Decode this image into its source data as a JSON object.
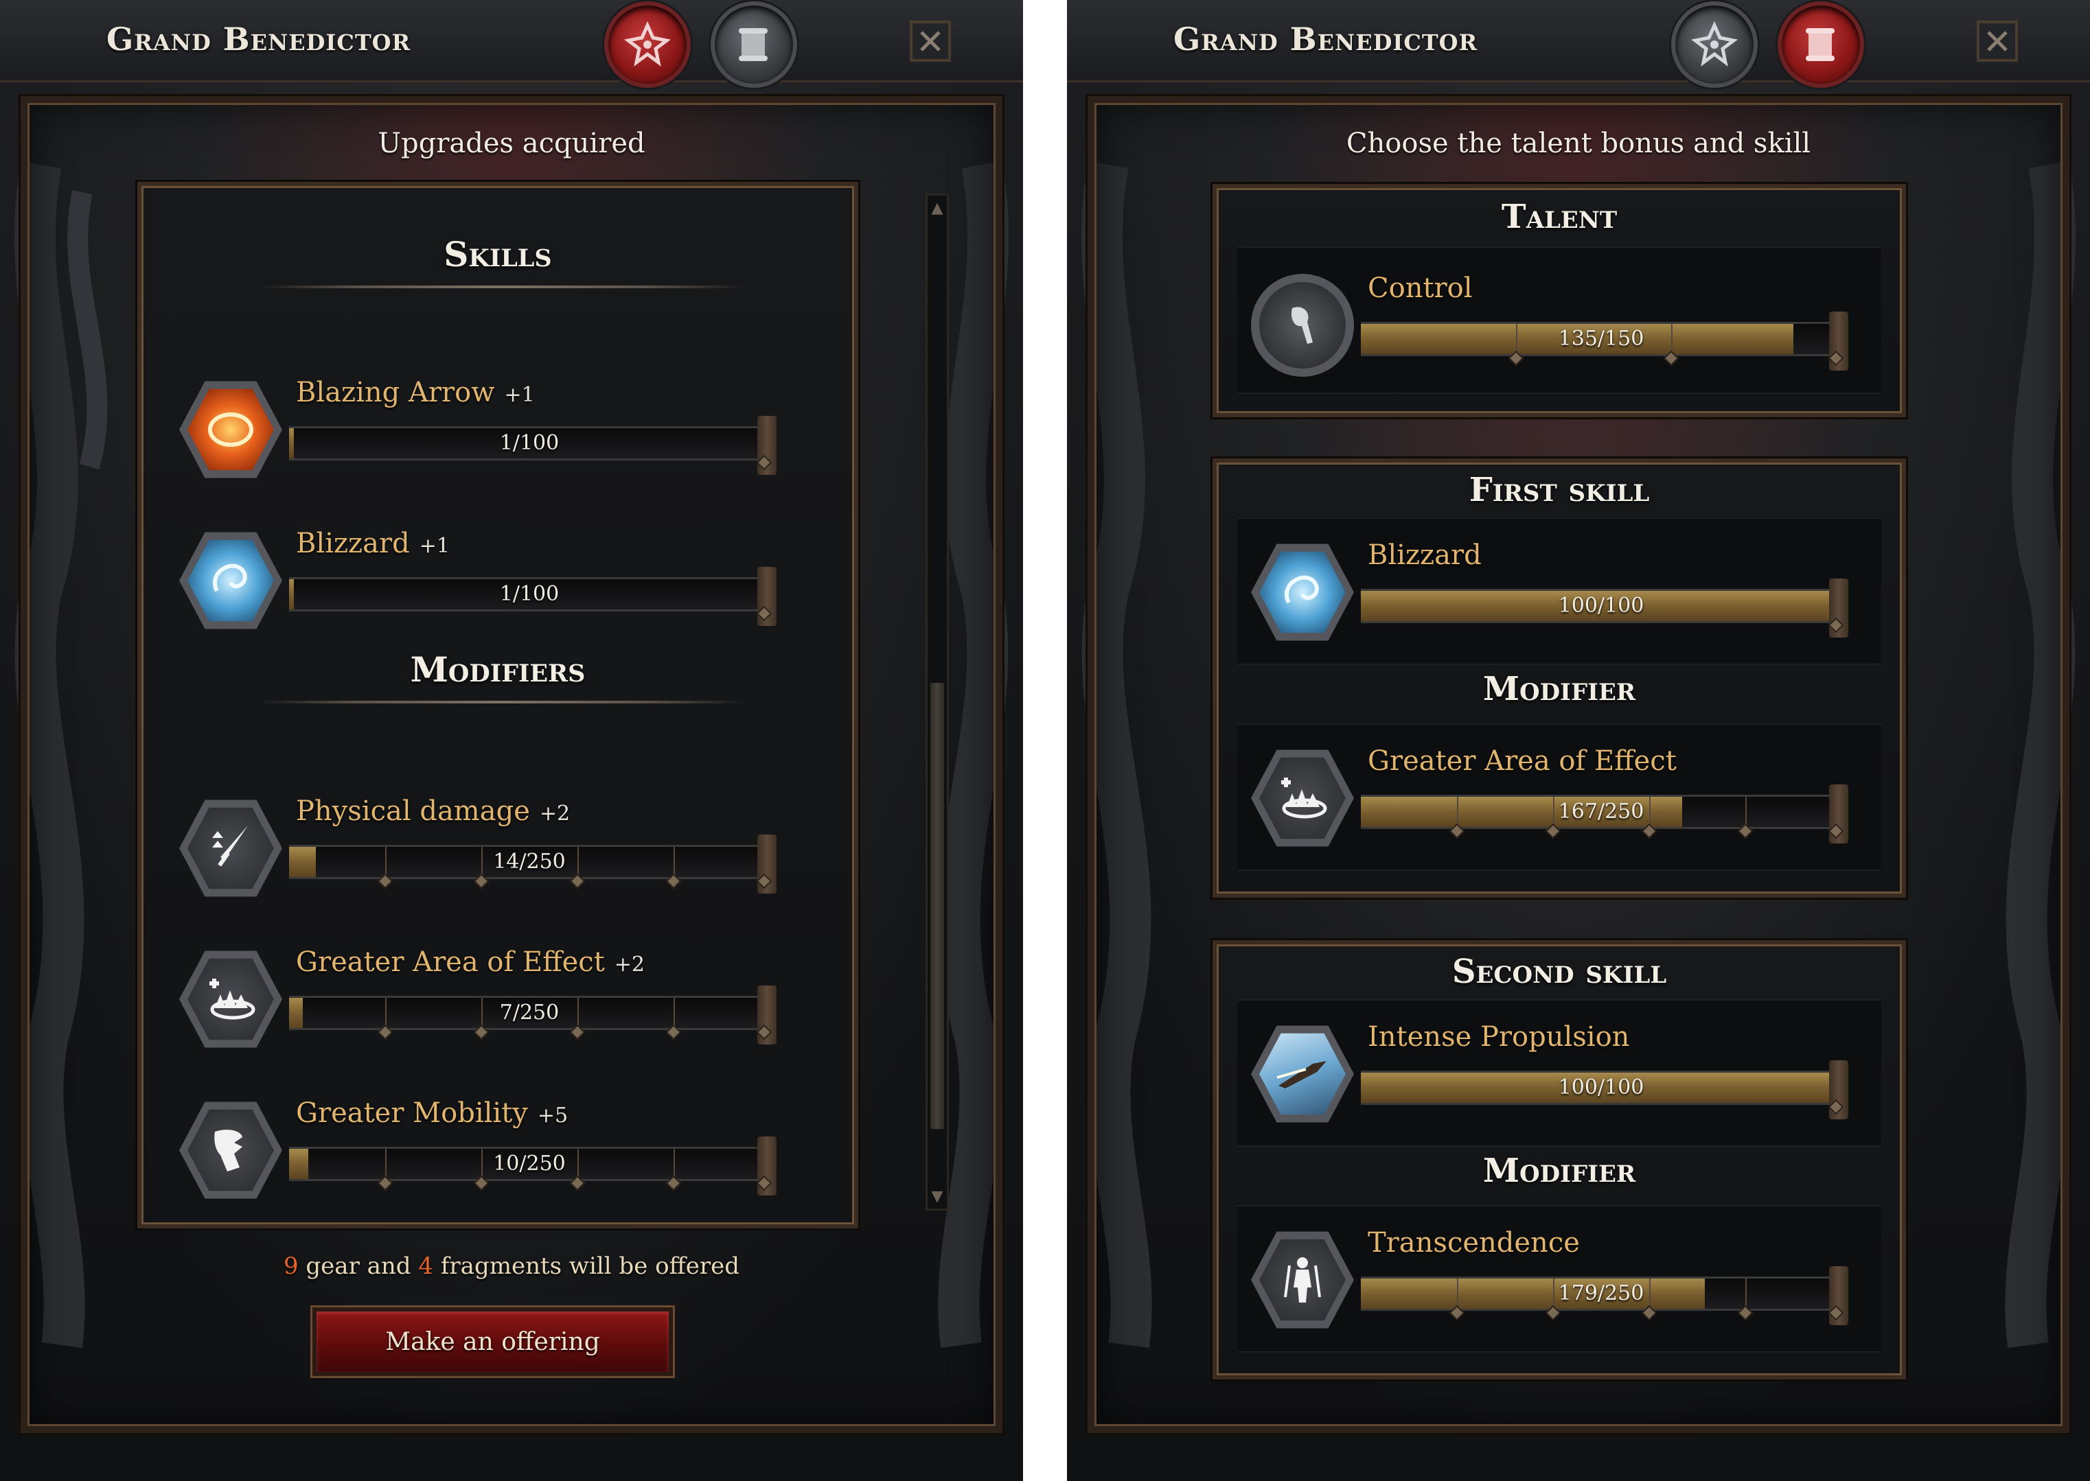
{
  "left": {
    "title": "Grand Benedictor",
    "subtitle": "Upgrades acquired",
    "skills_title": "Skills",
    "modifiers_title": "Modifiers",
    "skills": [
      {
        "name": "Blazing Arrow",
        "bonus": "+1",
        "value": "1/100",
        "progress": 0.01,
        "icon": "blazing-arrow-icon"
      },
      {
        "name": "Blizzard",
        "bonus": "+1",
        "value": "1/100",
        "progress": 0.01,
        "icon": "blizzard-icon"
      }
    ],
    "modifiers": [
      {
        "name": "Physical damage",
        "bonus": "+2",
        "value": "14/250",
        "progress": 0.056,
        "icon": "physical-damage-icon"
      },
      {
        "name": "Greater Area of Effect",
        "bonus": "+2",
        "value": "7/250",
        "progress": 0.028,
        "icon": "area-of-effect-icon"
      },
      {
        "name": "Greater Mobility",
        "bonus": "+5",
        "value": "10/250",
        "progress": 0.04,
        "icon": "mobility-icon"
      }
    ],
    "offer": {
      "gear": "9",
      "gear_text": "gear and",
      "fragments": "4",
      "fragments_text": "fragments will be offered"
    },
    "offer_button": "Make an offering"
  },
  "right": {
    "title": "Grand Benedictor",
    "subtitle": "Choose the talent bonus and skill",
    "talent_title": "Talent",
    "talent": {
      "name": "Control",
      "value": "135/150",
      "progress": 0.9,
      "icon": "control-icon"
    },
    "first_skill_title": "First skill",
    "first_skill": {
      "name": "Blizzard",
      "value": "100/100",
      "progress": 1.0,
      "icon": "blizzard-icon"
    },
    "first_modifier_title": "Modifier",
    "first_modifier": {
      "name": "Greater Area of Effect",
      "value": "167/250",
      "progress": 0.668,
      "icon": "area-of-effect-icon"
    },
    "second_skill_title": "Second skill",
    "second_skill": {
      "name": "Intense Propulsion",
      "value": "100/100",
      "progress": 1.0,
      "icon": "intense-propulsion-icon"
    },
    "second_modifier_title": "Modifier",
    "second_modifier": {
      "name": "Transcendence",
      "value": "179/250",
      "progress": 0.716,
      "icon": "transcendence-icon"
    }
  },
  "colors": {
    "accent_gold": "#e2b56f",
    "highlight_orange": "#e8622c",
    "button_red": "#8e1616"
  }
}
